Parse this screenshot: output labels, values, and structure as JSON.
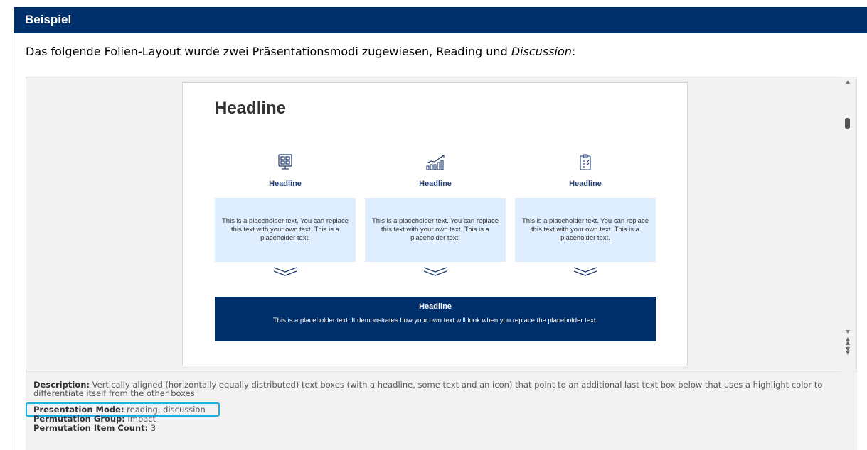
{
  "header": {
    "title": "Beispiel"
  },
  "intro": {
    "text_before": "Das folgende Folien-Layout wurde zwei Präsentationsmodi zugewiesen, Reading und ",
    "text_italic": "Discussion",
    "text_after": ":"
  },
  "slide": {
    "title": "Headline",
    "columns": [
      {
        "icon": "dashboard-monitor-icon",
        "headline": "Headline",
        "text": "This is a placeholder text. You can replace this text with your own text. This is a placeholder text."
      },
      {
        "icon": "growth-chart-icon",
        "headline": "Headline",
        "text": "This is a placeholder text. You can replace this text with your own text. This is a placeholder text."
      },
      {
        "icon": "clipboard-checklist-icon",
        "headline": "Headline",
        "text": "This is a placeholder text. You can replace this text with your own text. This is a placeholder text."
      }
    ],
    "highlight": {
      "headline": "Headline",
      "text": "This is a placeholder text. It demonstrates how your own text will look when you replace the placeholder text."
    }
  },
  "meta": {
    "description_label": "Description:",
    "description_value": " Vertically aligned (horizontally equally distributed) text boxes (with a headline, some text and an icon) that point to an additional last text box below that uses a highlight color to differentiate itself from the other boxes",
    "mode_label": "Presentation Mode:",
    "mode_value": " reading, discussion",
    "group_label": "Permutation Group:",
    "group_value": " impact",
    "count_label": "Permutation Item Count:",
    "count_value": " 3"
  },
  "colors": {
    "brand_navy": "#00306b",
    "box_light_blue": "#dfeeff",
    "highlight_cyan": "#17b0e0"
  }
}
